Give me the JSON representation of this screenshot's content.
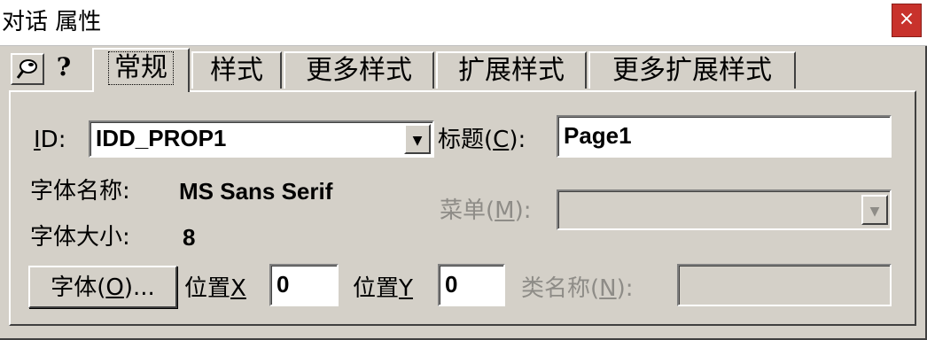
{
  "window": {
    "title": "对话 属性",
    "close_glyph": "×"
  },
  "toolbar": {
    "pin_icon": "pushpin-icon",
    "help_icon_glyph": "?"
  },
  "tabs": [
    {
      "label": "常规",
      "active": true
    },
    {
      "label": "样式",
      "active": false
    },
    {
      "label": "更多样式",
      "active": false
    },
    {
      "label": "扩展样式",
      "active": false
    },
    {
      "label": "更多扩展样式",
      "active": false
    }
  ],
  "general": {
    "id_label": "ID:",
    "id_label_underline": "I",
    "id_label_rest": "D:",
    "id_value": "IDD_PROP1",
    "caption_label_pre": "标题(",
    "caption_label_key": "C",
    "caption_label_post": "):",
    "caption_value": "Page1",
    "font_name_label": "字体名称:",
    "font_name_value": "MS Sans Serif",
    "menu_label_pre": "菜单(",
    "menu_label_key": "M",
    "menu_label_post": "):",
    "menu_value": "",
    "font_size_label": "字体大小:",
    "font_size_value": "8",
    "font_button_pre": "字体(",
    "font_button_key": "O",
    "font_button_post": ")...",
    "xpos_label_pre": "位置",
    "xpos_label_key": "X",
    "xpos_value": "0",
    "ypos_label_pre": "位置",
    "ypos_label_key": "Y",
    "ypos_value": "0",
    "class_label_pre": "类名称(",
    "class_label_key": "N",
    "class_label_post": "):",
    "class_value": ""
  },
  "colors": {
    "face": "#d4d0c8",
    "close": "#c8322c",
    "disabled_text": "#8e8c87"
  }
}
